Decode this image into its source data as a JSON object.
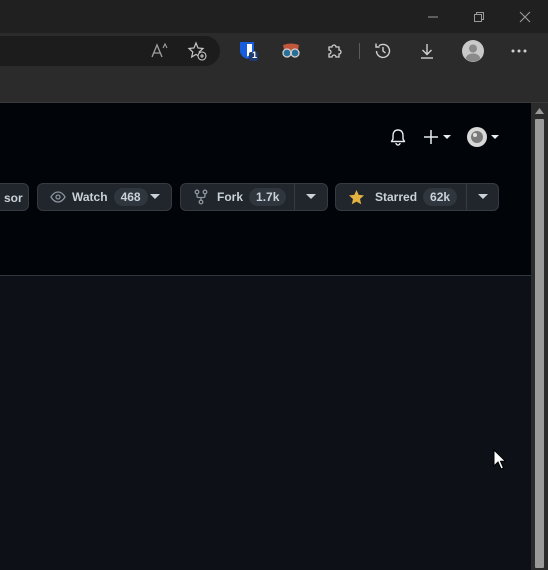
{
  "repo_actions": {
    "sponsor_label": "sor",
    "watch_label": "Watch",
    "watch_count": "468",
    "fork_label": "Fork",
    "fork_count": "1.7k",
    "star_label": "Starred",
    "star_count": "62k"
  },
  "extensions": {
    "bitwarden_badge": "1"
  },
  "colors": {
    "page_bg": "#0d1117",
    "header_bg": "#010409",
    "button_bg": "#21262d",
    "star_yellow": "#e3b341"
  },
  "icons": {
    "read_aloud": "read-aloud-icon",
    "favorites": "add-favorite-icon",
    "bitwarden": "bitwarden-icon",
    "extension_spy": "extension-glasses-icon",
    "extensions": "puzzle-icon",
    "history": "history-icon",
    "downloads": "download-icon",
    "profile": "profile-icon",
    "menu": "more-icon"
  }
}
